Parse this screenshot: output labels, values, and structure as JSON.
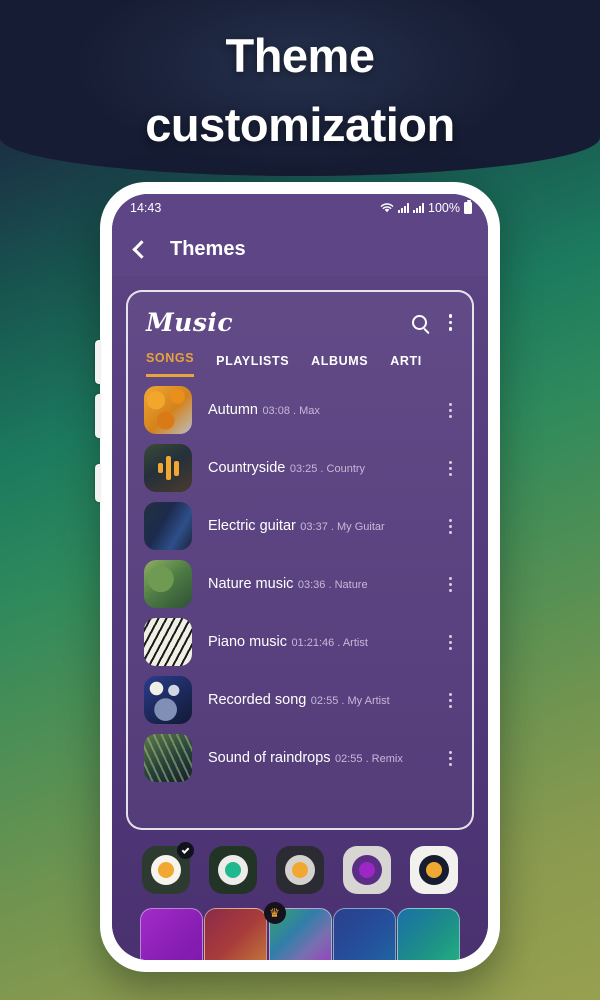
{
  "hero": {
    "title": "Theme\ncustomization"
  },
  "phone": {
    "status_bar": {
      "time": "14:43",
      "wifi_icon": "wifi-icon",
      "signal_icon": "signal-bars-icon",
      "battery_percent": "100%",
      "battery_icon": "battery-full-icon"
    },
    "app_bar": {
      "back_icon": "back-chevron-icon",
      "title": "Themes"
    },
    "music_app": {
      "logo": "Music",
      "search_icon": "search-icon",
      "menu_icon": "overflow-menu-icon",
      "tabs": [
        {
          "label": "SONGS",
          "active": true
        },
        {
          "label": "PLAYLISTS",
          "active": false
        },
        {
          "label": "ALBUMS",
          "active": false
        },
        {
          "label": "ARTI",
          "active": false
        }
      ],
      "songs": [
        {
          "title": "Autumn",
          "duration": "03:08",
          "artist": "Max",
          "sub": "03:08 . Max",
          "art": "art-autumn",
          "playing": false
        },
        {
          "title": "Countryside",
          "duration": "03:25",
          "artist": "Country",
          "sub": "03:25 . Country",
          "art": "art-country",
          "playing": true
        },
        {
          "title": "Electric guitar",
          "duration": "03:37",
          "artist": "My Guitar",
          "sub": "03:37 . My Guitar",
          "art": "art-guitar",
          "playing": false
        },
        {
          "title": "Nature music",
          "duration": "03:36",
          "artist": "Nature",
          "sub": "03:36 . Nature",
          "art": "art-nature",
          "playing": false
        },
        {
          "title": "Piano music",
          "duration": "01:21:46",
          "artist": "Artist",
          "sub": "01:21:46 . Artist",
          "art": "art-piano",
          "playing": false
        },
        {
          "title": "Recorded song",
          "duration": "02:55",
          "artist": "My Artist",
          "sub": "02:55 . My Artist",
          "art": "art-recorded",
          "playing": false
        },
        {
          "title": "Sound of raindrops",
          "duration": "02:55",
          "artist": "Remix",
          "sub": "02:55 . Remix",
          "art": "art-rain",
          "playing": false
        }
      ]
    },
    "theme_swatches": [
      {
        "name": "swatch-dark-orange",
        "bg": "#2d3a30",
        "outer": "#f7f4ee",
        "inner": "#f0a832",
        "selected": true
      },
      {
        "name": "swatch-dark-teal",
        "bg": "#223426",
        "outer": "#eeecea",
        "inner": "#22b88e",
        "selected": false
      },
      {
        "name": "swatch-black-orange",
        "bg": "#2b2b33",
        "outer": "#d4d2cf",
        "inner": "#f0a832",
        "selected": false
      },
      {
        "name": "swatch-light-purple",
        "bg": "#d8d6d2",
        "outer": "#5b2e86",
        "inner": "#9c27c4",
        "selected": false
      },
      {
        "name": "swatch-white-orange",
        "bg": "#f3f1ee",
        "outer": "#171c2e",
        "inner": "#f0a832",
        "selected": false
      }
    ],
    "theme_previews": [
      {
        "name": "preview-purple",
        "gradient": "linear-gradient(135deg,#a32bc9 0%,#8a1fb5 50%,#7b17a8 100%)",
        "premium": false
      },
      {
        "name": "preview-red-orange",
        "gradient": "linear-gradient(135deg,#8c2a4a 0%,#a83b3b 45%,#c98a3a 100%)",
        "premium": false
      },
      {
        "name": "preview-multicolor",
        "gradient": "linear-gradient(135deg,#3aa06b 0%,#2f7fa8 35%,#7a6fb0 60%,#a52bc4 100%)",
        "premium": true
      },
      {
        "name": "preview-blue",
        "gradient": "linear-gradient(135deg,#2b3f8c 0%,#25509b 50%,#1d6fa5 100%)",
        "premium": false
      },
      {
        "name": "preview-green-teal",
        "gradient": "linear-gradient(135deg,#1c6fa8 0%,#1d8f88 50%,#25bd7e 100%)",
        "premium": false
      }
    ],
    "crown_icon": "crown-premium-icon"
  },
  "colors": {
    "accent_orange": "#e8a33d",
    "app_purple": "#5e4585",
    "hero_navy": "#161c33"
  }
}
